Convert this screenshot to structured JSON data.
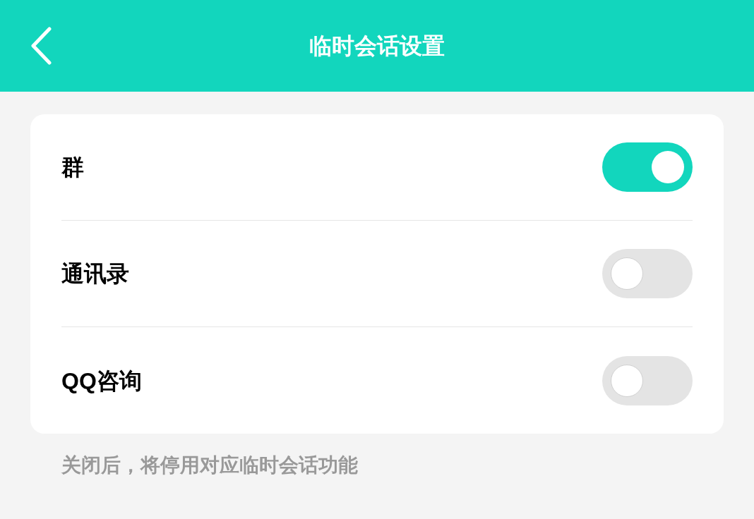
{
  "header": {
    "title": "临时会话设置"
  },
  "settings": [
    {
      "label": "群",
      "on": true
    },
    {
      "label": "通讯录",
      "on": false
    },
    {
      "label": "QQ咨询",
      "on": false
    }
  ],
  "footnote": "关闭后，将停用对应临时会话功能"
}
